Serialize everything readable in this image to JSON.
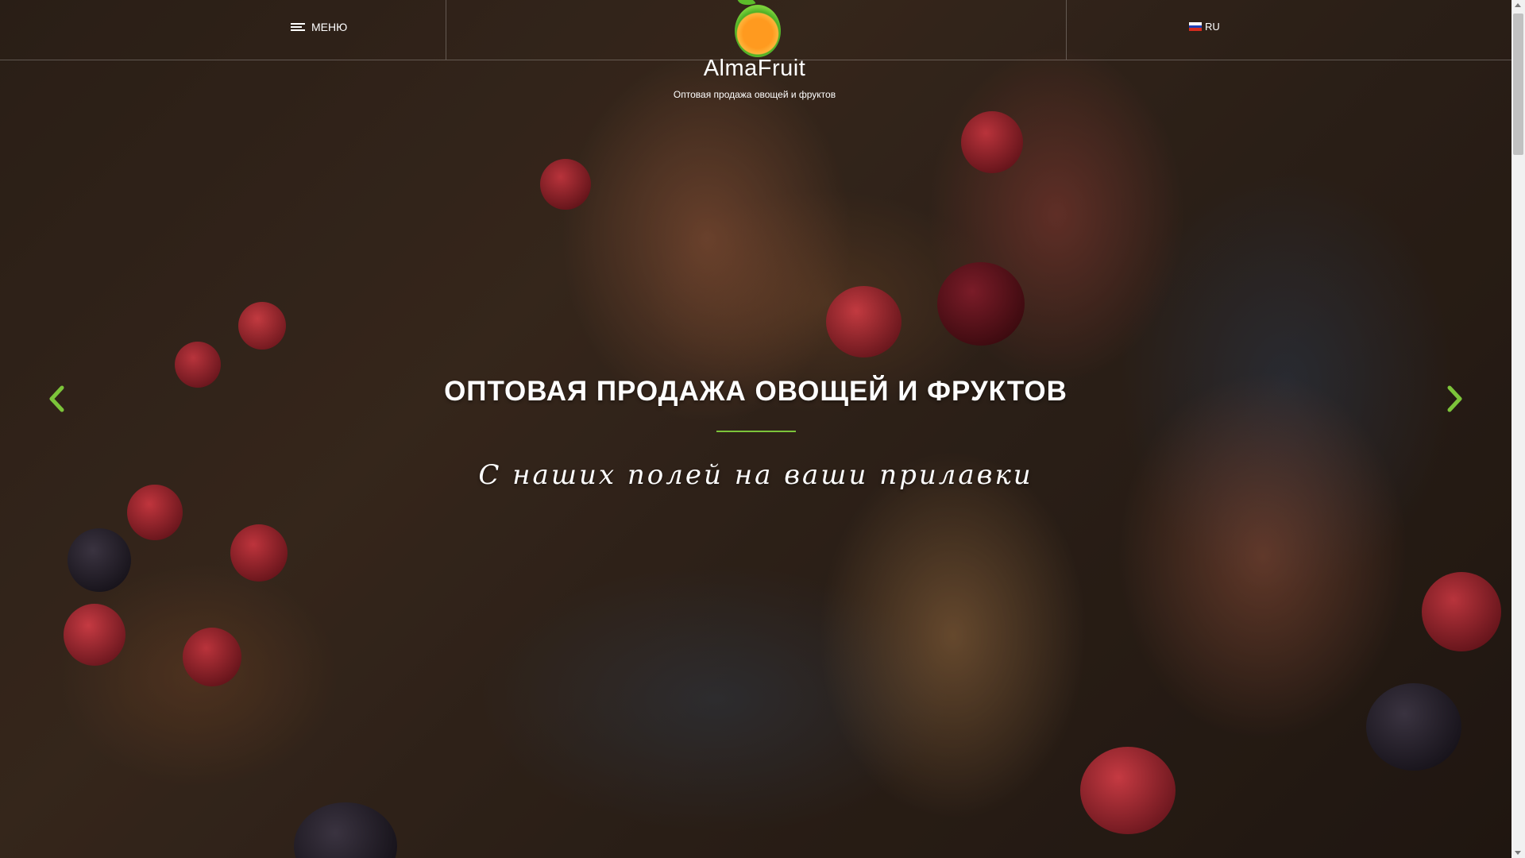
{
  "header": {
    "menu_label": "МЕНЮ",
    "menu_icon": "hamburger-icon",
    "language_label": "RU",
    "language_flag_icon": "russian-flag-icon"
  },
  "logo": {
    "name": "AlmaFruit",
    "subtitle": "Оптовая продажа овощей и фруктов"
  },
  "hero": {
    "title": "ОПТОВАЯ ПРОДАЖА ОВОЩЕЙ И ФРУКТОВ",
    "tagline": "С наших полей на ваши прилавки",
    "prev_icon": "chevron-left-icon",
    "next_icon": "chevron-right-icon",
    "accent_color": "#7cc43a"
  }
}
